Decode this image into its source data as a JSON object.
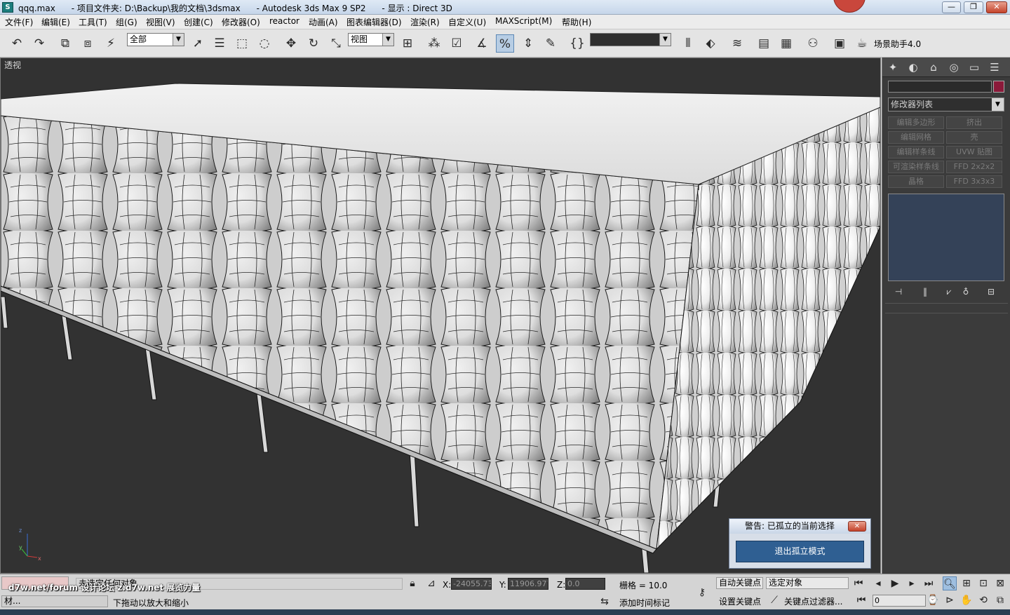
{
  "window": {
    "title": "qqq.max      - 项目文件夹: D:\\Backup\\我的文档\\3dsmax      - Autodesk 3ds Max 9 SP2      - 显示 : Direct 3D",
    "minimize_label": "—",
    "maximize_label": "❐",
    "close_label": "✕"
  },
  "menu": [
    "文件(F)",
    "编辑(E)",
    "工具(T)",
    "组(G)",
    "视图(V)",
    "创建(C)",
    "修改器(O)",
    "reactor",
    "动画(A)",
    "图表编辑器(D)",
    "渲染(R)",
    "自定义(U)",
    "MAXScript(M)",
    "帮助(H)"
  ],
  "toolbar": {
    "selection_filter": "全部",
    "ref_coord": "视图",
    "named_selection": "",
    "scene_helper": "场景助手4.0"
  },
  "viewport": {
    "label": "透视",
    "bg_color": "#323232"
  },
  "warning_dialog": {
    "title": "警告: 已孤立的当前选择",
    "button": "退出孤立模式"
  },
  "command_panel": {
    "object_color": "#8b1a3a",
    "modifier_list": "修改器列表",
    "modifier_buttons": [
      "编辑多边形",
      "挤出",
      "编辑网格",
      "壳",
      "编辑样条线",
      "UVW 贴图",
      "可渲染样条线",
      "FFD 2x2x2",
      "晶格",
      "FFD 3x3x3"
    ]
  },
  "status": {
    "selection": "未选定任何对象",
    "prompt": "下拖动以放大和缩小",
    "x_label": "X:",
    "x_value": "-24055.73",
    "y_label": "Y:",
    "y_value": "11906.977",
    "z_label": "Z:",
    "z_value": "0.0",
    "grid": "栅格 = 10.0",
    "add_time_tag": "添加时间标记",
    "auto_key": "自动关键点",
    "set_key": "设置关键点",
    "key_mode": "选定对象",
    "key_filters": "关键点过滤器...",
    "frame": "0",
    "maxscript_label": "材..."
  },
  "watermark": "d7w.net/forum 设计论坛 z.d7w.net 展览力量"
}
